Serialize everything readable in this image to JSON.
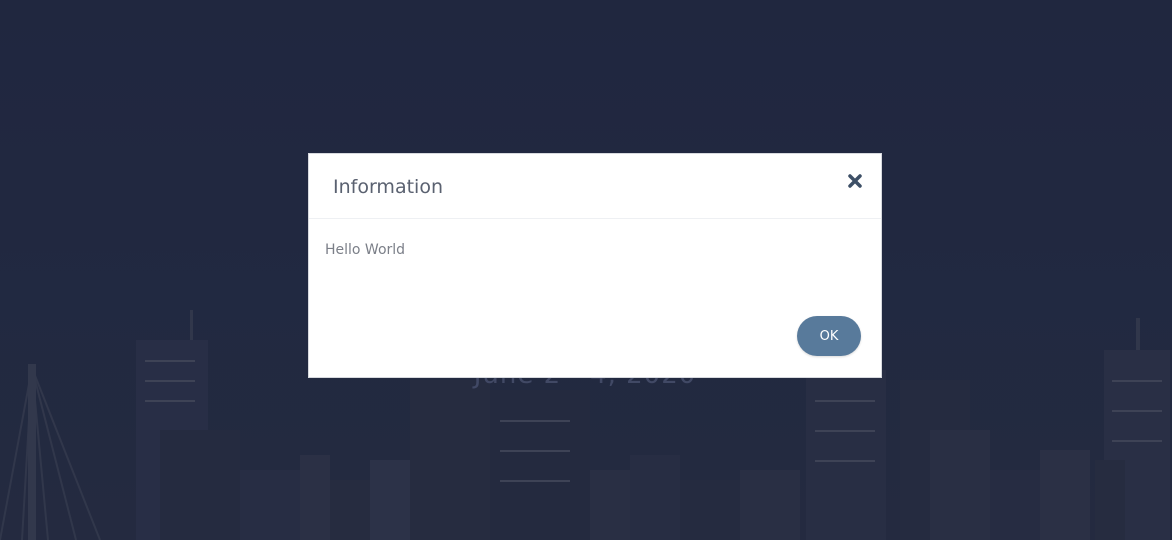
{
  "background": {
    "event_date": "June 2 - 4, 2020",
    "image": "city-skyline-background"
  },
  "dialog": {
    "title": "Information",
    "message": "Hello World",
    "ok_label": "OK",
    "close_icon": "close-icon"
  },
  "colors": {
    "backdrop": "#262d48",
    "dialog_background": "#ffffff",
    "title_text": "#5a6170",
    "message_text": "#7b7f88",
    "ok_button": "#587a9b",
    "close_icon": "#3d4f66"
  }
}
